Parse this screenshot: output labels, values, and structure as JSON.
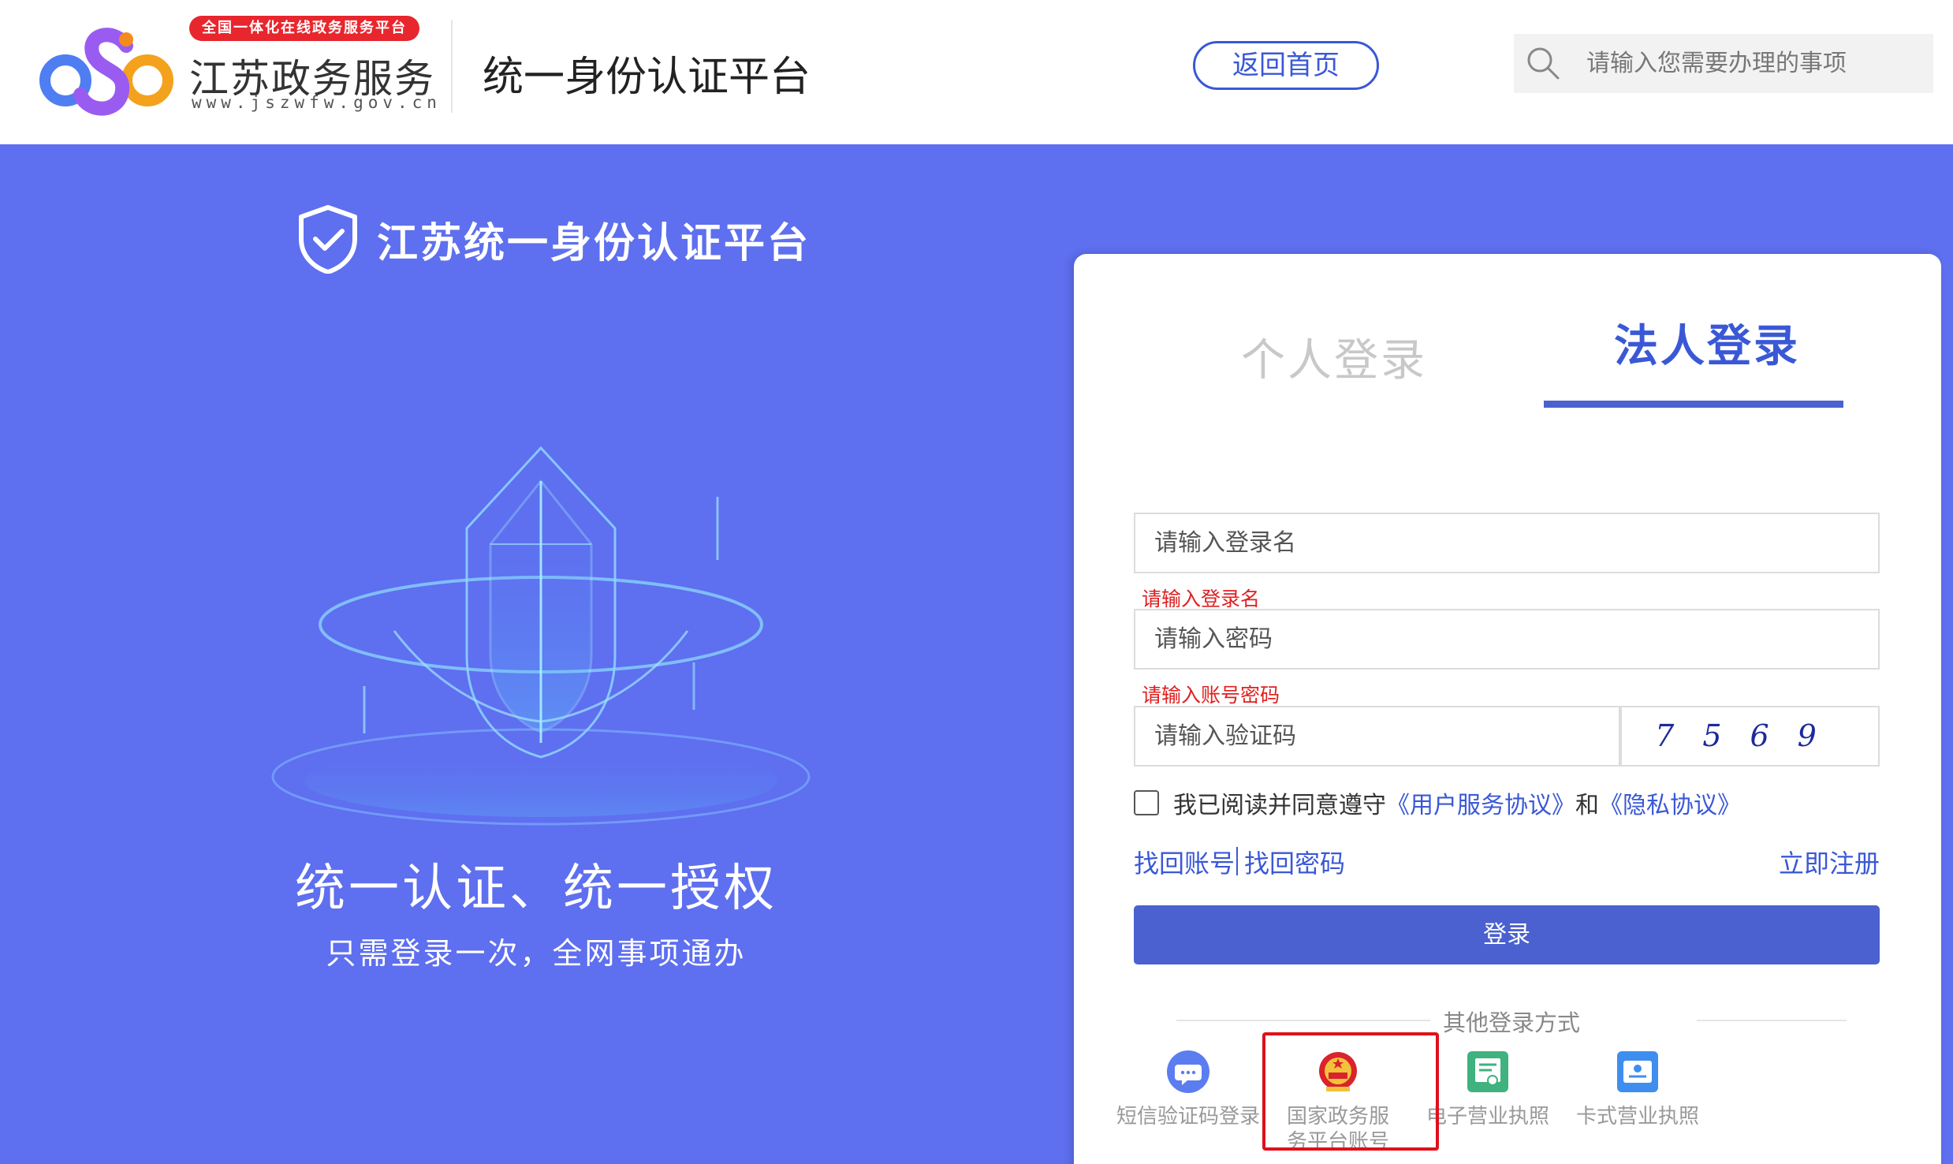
{
  "header": {
    "logo_badge": "全国一体化在线政务服务平台",
    "logo_title": "江苏政务服务",
    "logo_url": "www.jszwfw.gov.cn",
    "platform_title": "统一身份认证平台",
    "home_button": "返回首页",
    "search_placeholder": "请输入您需要办理的事项"
  },
  "hero": {
    "title": "江苏统一身份认证平台",
    "slogan": "统一认证、统一授权",
    "subtitle": "只需登录一次，全网事项通办"
  },
  "login": {
    "tabs": [
      {
        "label": "个人登录",
        "active": false
      },
      {
        "label": "法人登录",
        "active": true
      }
    ],
    "username_placeholder": "请输入登录名",
    "username_error": "请输入登录名",
    "password_placeholder": "请输入密码",
    "password_error": "请输入账号密码",
    "captcha_placeholder": "请输入验证码",
    "captcha_value": "7569",
    "agreement": {
      "prefix": "我已阅读并同意遵守",
      "user_agreement": "《用户服务协议》",
      "and": "和",
      "privacy": "《隐私协议》",
      "checked": false
    },
    "recover_account": "找回账号",
    "recover_password": "找回密码",
    "register": "立即注册",
    "submit": "登录",
    "other_methods_title": "其他登录方式",
    "methods": [
      {
        "icon": "sms-icon",
        "label": "短信验证码登录"
      },
      {
        "icon": "national-emblem-icon",
        "label": "国家政务服务平台账号登录"
      },
      {
        "icon": "electronic-license-icon",
        "label": "电子营业执照"
      },
      {
        "icon": "card-license-icon",
        "label": "卡式营业执照"
      }
    ]
  },
  "colors": {
    "background": "#5e6fef",
    "accent": "#3a58d6",
    "button": "#4a61cf",
    "error": "#e02020",
    "highlight": "#e0101a"
  }
}
